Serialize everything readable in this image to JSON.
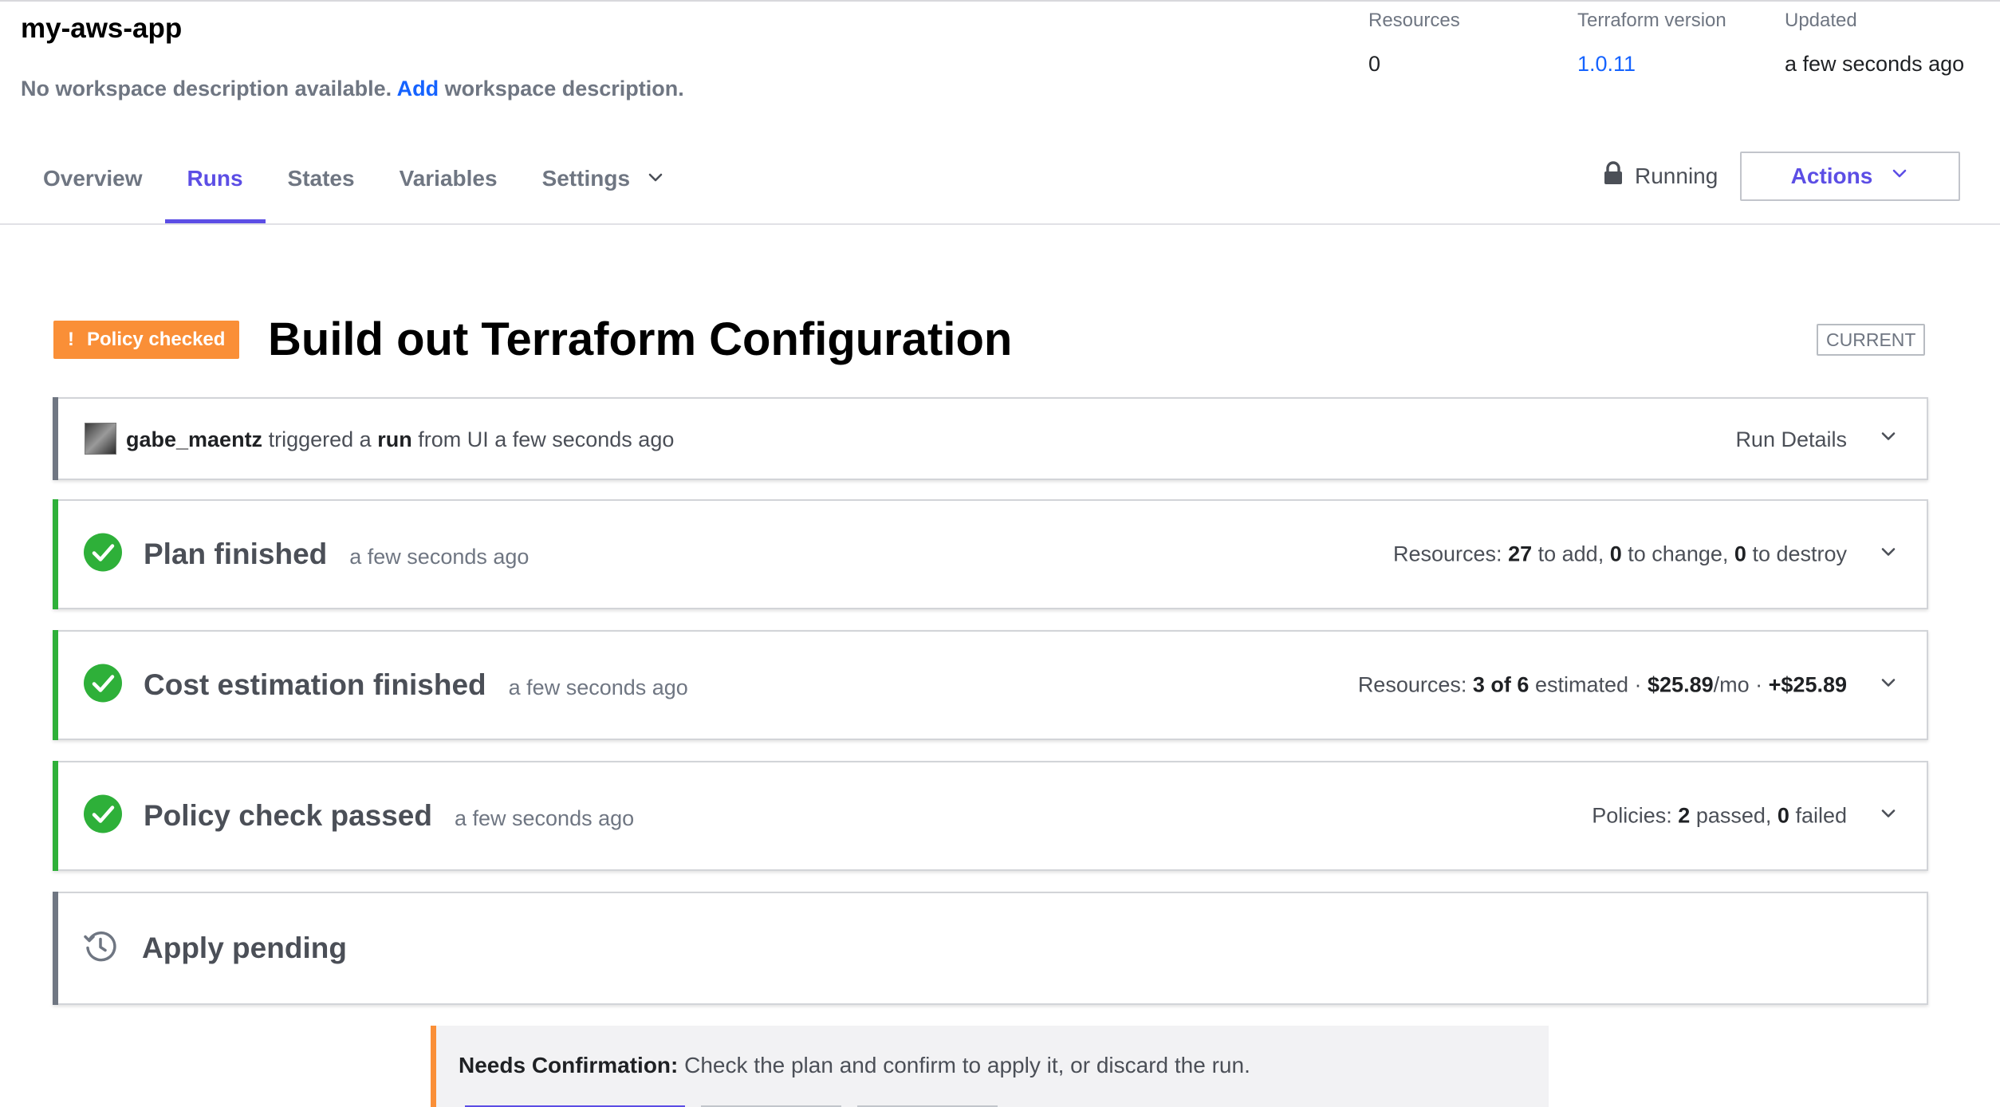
{
  "workspace": {
    "name": "my-aws-app",
    "desc_before": "No workspace description available.",
    "desc_link": "Add",
    "desc_after": "workspace description."
  },
  "meta": {
    "resources_label": "Resources",
    "resources_value": "0",
    "tf_version_label": "Terraform version",
    "tf_version_value": "1.0.11",
    "updated_label": "Updated",
    "updated_value": "a few seconds ago"
  },
  "tabs": [
    {
      "label": "Overview"
    },
    {
      "label": "Runs",
      "active": true
    },
    {
      "label": "States"
    },
    {
      "label": "Variables"
    },
    {
      "label": "Settings",
      "has_dropdown": true
    }
  ],
  "lock": {
    "icon": "lock-icon",
    "label": "Running"
  },
  "actions_button": {
    "label": "Actions"
  },
  "run": {
    "badge_symbol": "!",
    "badge_label": "Policy checked",
    "title": "Build out Terraform Configuration",
    "current_tag": "CURRENT"
  },
  "trigger": {
    "user": "gabe_maentz",
    "t1": "triggered a",
    "run_word": "run",
    "t2": "from UI a few seconds ago",
    "details_label": "Run Details"
  },
  "steps": {
    "plan": {
      "title": "Plan finished",
      "time": "a few seconds ago",
      "s_label": "Resources:",
      "add": "27",
      "add_text": "to add,",
      "change": "0",
      "change_text": "to change,",
      "destroy": "0",
      "destroy_text": "to destroy"
    },
    "cost": {
      "title": "Cost estimation finished",
      "time": "a few seconds ago",
      "s_label": "Resources:",
      "estimated": "3 of 6",
      "estimated_text": "estimated ·",
      "monthly": "$25.89",
      "monthly_text": "/mo ·",
      "delta": "+$25.89"
    },
    "policy": {
      "title": "Policy check passed",
      "time": "a few seconds ago",
      "s_label": "Policies:",
      "passed": "2",
      "passed_text": "passed,",
      "failed": "0",
      "failed_text": "failed"
    },
    "apply": {
      "title": "Apply pending"
    }
  },
  "confirm": {
    "label": "Needs Confirmation:",
    "text": "Check the plan and confirm to apply it, or discard the run."
  },
  "colors": {
    "accent": "#5c4ee5",
    "link": "#1563ff",
    "success": "#2eb039",
    "warning": "#fa8f37"
  }
}
